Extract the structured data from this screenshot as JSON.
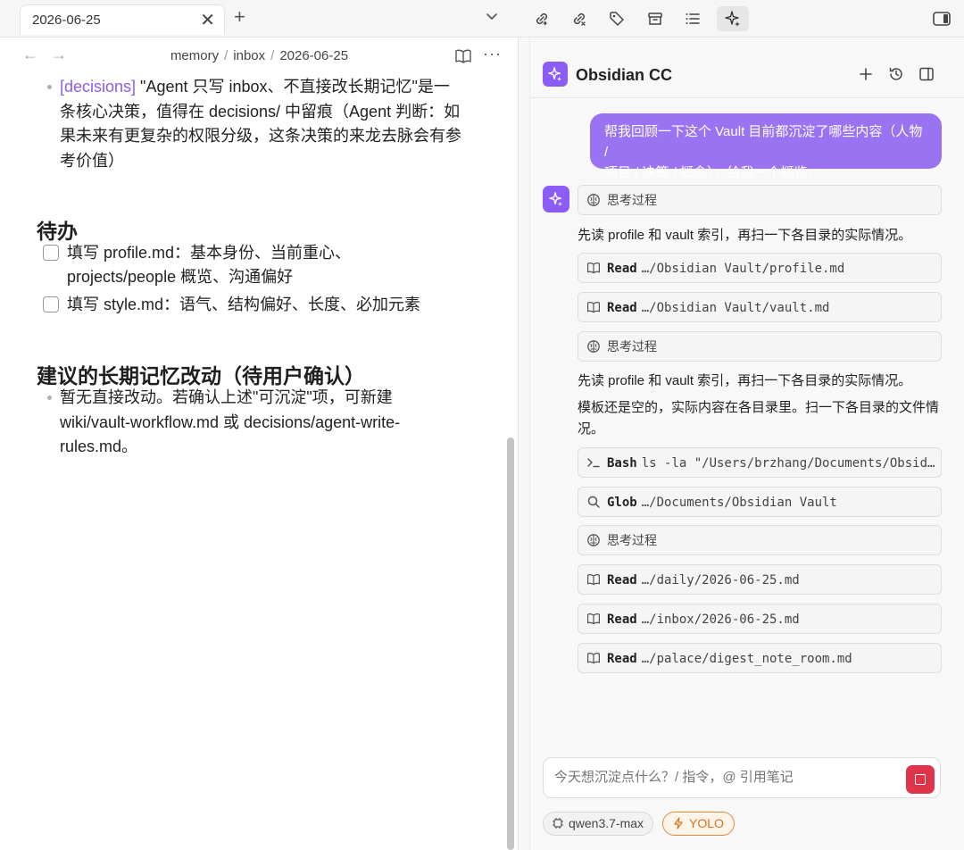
{
  "left": {
    "tab": {
      "title": "2026-06-25"
    },
    "breadcrumb": {
      "parts": [
        "memory",
        "inbox",
        "2026-06-25"
      ],
      "sep": "/"
    },
    "content": {
      "decision_bullet": {
        "tag": "[decisions]",
        "lines": [
          " \"Agent 只写 inbox、不直接改长期记忆\"是一",
          "条核心决策，值得在 decisions/ 中留痕（Agent 判断：如",
          "果未来有更复杂的权限分级，这条决策的来龙去脉会有参",
          "考价值）"
        ]
      },
      "todo_heading": "待办",
      "todos": [
        {
          "lines": [
            "填写 profile.md：基本身份、当前重心、",
            "projects/people 概览、沟通偏好"
          ]
        },
        {
          "lines": [
            "填写 style.md：语气、结构偏好、长度、必加元素"
          ]
        }
      ],
      "proposal_heading": "建议的长期记忆改动（待用户确认）",
      "proposal_bullet": {
        "lines": [
          "暂无直接改动。若确认上述\"可沉淀\"项，可新建",
          "wiki/vault-workflow.md 或 decisions/agent-write-",
          "rules.md。"
        ]
      }
    }
  },
  "right": {
    "toolbar_icons": [
      "link-icon",
      "unlink-icon",
      "tag-icon",
      "archive-icon",
      "list-icon",
      "sparkle-icon",
      "sidebar-toggle-icon"
    ],
    "chat": {
      "title": "Obsidian CC",
      "user_message": {
        "lines": [
          "帮我回顾一下这个 Vault 目前都沉淀了哪些内容（人物 /",
          "项目 / 决策 / 概念），给我一个概览。"
        ]
      },
      "thinking_label": "思考过程",
      "paragraph_1": "先读 profile 和 vault 索引，再扫一下各目录的实际情况。",
      "paragraph_2": "先读 profile 和 vault 索引，再扫一下各目录的实际情况。",
      "paragraph_3": [
        "模板还是空的，实际内容在各目录里。扫一下各目录的文件情",
        "况。"
      ],
      "tools": [
        {
          "verb": "Read",
          "path": "…/Obsidian Vault/profile.md",
          "icon": "book-icon"
        },
        {
          "verb": "Read",
          "path": "…/Obsidian Vault/vault.md",
          "icon": "book-icon"
        },
        {
          "verb": "Bash",
          "path": "ls -la \"/Users/brzhang/Documents/Obsid…",
          "icon": "terminal-icon"
        },
        {
          "verb": "Glob",
          "path": "…/Documents/Obsidian Vault",
          "icon": "search-icon"
        },
        {
          "verb": "Read",
          "path": "…/daily/2026-06-25.md",
          "icon": "book-icon"
        },
        {
          "verb": "Read",
          "path": "…/inbox/2026-06-25.md",
          "icon": "book-icon"
        },
        {
          "verb": "Read",
          "path": "…/palace/digest_note_room.md",
          "icon": "book-icon"
        }
      ],
      "composer": {
        "placeholder": "今天想沉淀点什么？/ 指令，@ 引用笔记"
      },
      "model": "qwen3.7-max",
      "mode": "YOLO"
    }
  },
  "colors": {
    "accent": "#8b5cf6",
    "user_bubble": "#9a73f2",
    "tag_link": "#8a5cf5",
    "stop_button": "#e0344b",
    "yolo": "#d4722a"
  }
}
